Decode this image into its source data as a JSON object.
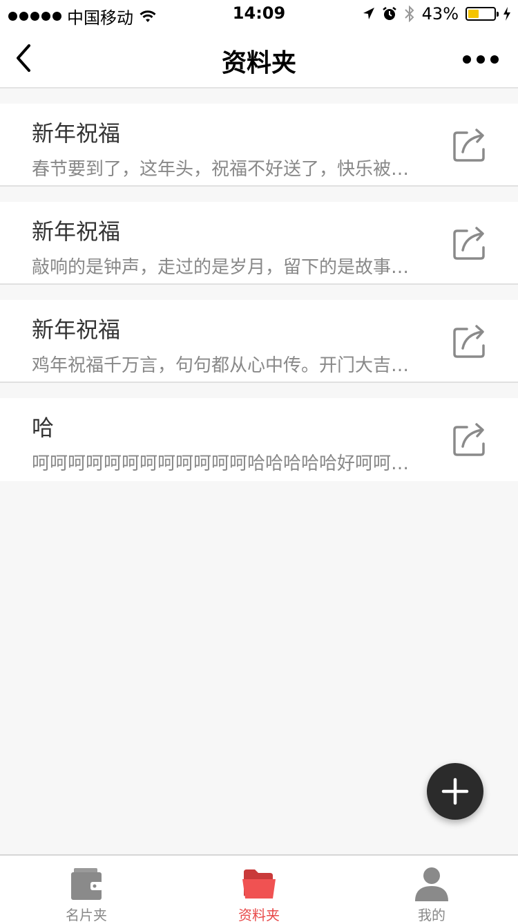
{
  "status_bar": {
    "carrier": "中国移动",
    "time": "14:09",
    "battery": "43%"
  },
  "nav": {
    "title": "资料夹"
  },
  "items": [
    {
      "title": "新年祝福",
      "summary": "春节要到了，这年头，祝福不好送了，快乐被…"
    },
    {
      "title": "新年祝福",
      "summary": "敲响的是钟声，走过的是岁月，留下的是故事…"
    },
    {
      "title": "新年祝福",
      "summary": "鸡年祝福千万言，句句都从心中传。开门大吉…"
    },
    {
      "title": "哈",
      "summary": "呵呵呵呵呵呵呵呵呵呵呵呵哈哈哈哈哈好呵呵…"
    }
  ],
  "tabs": [
    {
      "label": "名片夹",
      "icon": "wallet-icon",
      "active": false
    },
    {
      "label": "资料夹",
      "icon": "folder-icon",
      "active": true
    },
    {
      "label": "我的",
      "icon": "person-icon",
      "active": false
    }
  ],
  "colors": {
    "accent": "#e84a4a",
    "icon_gray": "#8a8a8a",
    "fab": "#2b2b2b",
    "battery_fill": "#f5c400"
  }
}
